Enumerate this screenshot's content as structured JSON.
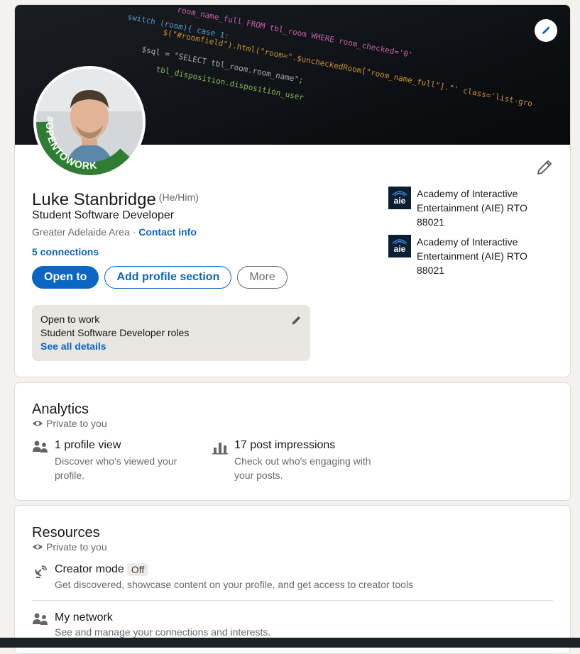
{
  "profile": {
    "name": "Luke Stanbridge",
    "pronouns": "(He/Him)",
    "headline": "Student Software Developer",
    "location": "Greater Adelaide Area",
    "location_separator": " · ",
    "contact_info": "Contact info",
    "connections": "5 connections",
    "open_to_ribbon": "#OPENTOWORK",
    "actions": {
      "open_to": "Open to",
      "add_section": "Add profile section",
      "more": "More"
    },
    "open_to_work": {
      "title": "Open to work",
      "roles": "Student Software Developer roles",
      "details_link": "See all details"
    },
    "education": [
      {
        "logo_text": "aie",
        "name": "Academy of Interactive Entertainment (AIE) RTO 88021"
      },
      {
        "logo_text": "aie",
        "name": "Academy of Interactive Entertainment (AIE) RTO 88021"
      }
    ]
  },
  "banner_code": [
    "room_name_full FROM tbl_room WHERE room_checked='0'",
    "$(\"#roomfield\").html(\"room=\".$uncheckedRoom[\"room_name_full\"].\"' class='list-gro",
    "tbl_disposition.disposition_user",
    "switch (room){ case 1:",
    "$sql = \"SELECT tbl_room.room_name\";"
  ],
  "analytics": {
    "title": "Analytics",
    "privacy": "Private to you",
    "stats": [
      {
        "icon": "people-icon",
        "title": "1 profile view",
        "desc": "Discover who's viewed your profile."
      },
      {
        "icon": "bar-chart-icon",
        "title": "17 post impressions",
        "desc": "Check out who's engaging with your posts."
      }
    ]
  },
  "resources": {
    "title": "Resources",
    "privacy": "Private to you",
    "items": [
      {
        "icon": "satellite-dish-icon",
        "title": "Creator mode",
        "badge": "Off",
        "desc": "Get discovered, showcase content on your profile, and get access to creator tools"
      },
      {
        "icon": "people-icon",
        "title": "My network",
        "desc": "See and manage your connections and interests."
      }
    ]
  },
  "colors": {
    "brand_blue": "#0a66c2",
    "otw_green": "#2f7d32",
    "background": "#f3f2ef"
  }
}
